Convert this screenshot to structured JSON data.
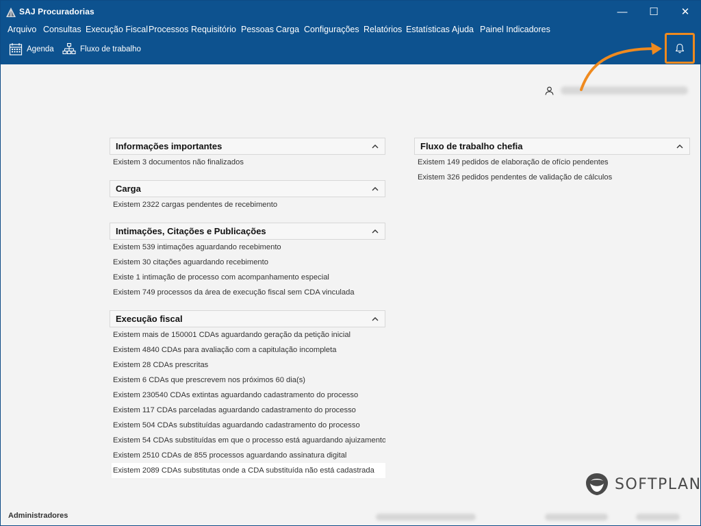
{
  "window": {
    "title": "SAJ Procuradorias",
    "minimize": "—",
    "maximize": "☐",
    "close": "✕"
  },
  "menu": [
    "Arquivo",
    "Consultas",
    "Execução Fiscal",
    "Processos",
    "Requisitório",
    "Pessoas",
    "Carga",
    "Configurações",
    "Relatórios",
    "Estatísticas",
    "Ajuda",
    "Painel Indicadores"
  ],
  "toolbar": {
    "agenda": "Agenda",
    "fluxo": "Fluxo de trabalho",
    "bell_icon": "bell-icon"
  },
  "panels": {
    "info": {
      "title": "Informações importantes",
      "rows": [
        "Existem  3 documentos não finalizados"
      ]
    },
    "carga": {
      "title": "Carga",
      "rows": [
        "Existem  2322 cargas pendentes de recebimento"
      ]
    },
    "intimacoes": {
      "title": "Intimações, Citações e Publicações",
      "rows": [
        "Existem  539 intimações aguardando recebimento",
        "Existem  30 citações aguardando recebimento",
        "Existe 1 intimação de processo com acompanhamento especial",
        "Existem  749 processos da área de execução fiscal sem CDA vinculada"
      ]
    },
    "execucao": {
      "title": "Execução fiscal",
      "rows": [
        "Existem mais de 150001 CDAs aguardando geração da petição inicial",
        "Existem  4840 CDAs para avaliação com a capitulação incompleta",
        "Existem  28 CDAs prescritas",
        "Existem  6 CDAs que prescrevem nos próximos 60 dia(s)",
        "Existem  230540 CDAs extintas aguardando cadastramento do processo",
        "Existem  117 CDAs parceladas aguardando cadastramento do processo",
        "Existem  504 CDAs substituídas aguardando cadastramento do processo",
        "Existem  54 CDAs substituídas em que o processo está aguardando ajuizamento",
        "Existem  2510 CDAs de 855 processos aguardando assinatura digital",
        "Existem  2089 CDAs substitutas onde a CDA substituída não está cadastrada"
      ]
    },
    "chefia": {
      "title": "Fluxo de trabalho chefia",
      "rows": [
        "Existem  149 pedidos de elaboração de ofício pendentes",
        "Existem  326 pedidos pendentes de validação de cálculos"
      ]
    }
  },
  "brand": "SOFTPLAN",
  "status": {
    "profile": "Administradores"
  },
  "colors": {
    "header_blue": "#0d528f",
    "annotation_orange": "#ef8a1f"
  }
}
